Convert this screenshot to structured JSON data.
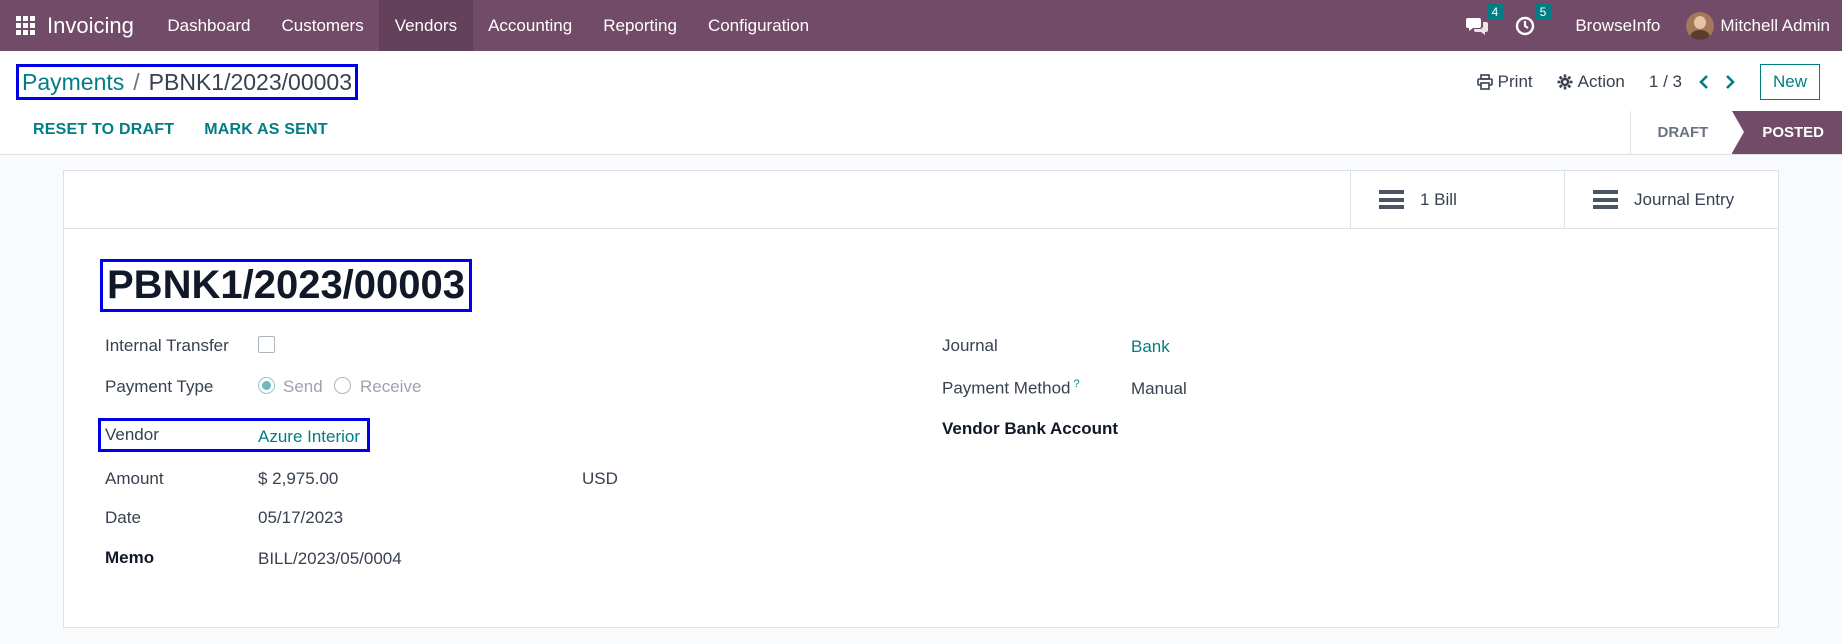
{
  "navbar": {
    "app_name": "Invoicing",
    "menu": [
      "Dashboard",
      "Customers",
      "Vendors",
      "Accounting",
      "Reporting",
      "Configuration"
    ],
    "active_menu": "Vendors",
    "messages_count": "4",
    "activities_count": "5",
    "company": "BrowseInfo",
    "user": "Mitchell Admin"
  },
  "breadcrumb": {
    "parent": "Payments",
    "separator": "/",
    "current": "PBNK1/2023/00003"
  },
  "toolbar": {
    "print_label": "Print",
    "action_label": "Action",
    "pager": "1 / 3",
    "new_label": "New"
  },
  "actions": {
    "reset_label": "RESET TO DRAFT",
    "mark_sent_label": "MARK AS SENT"
  },
  "status": {
    "draft": "DRAFT",
    "posted": "POSTED",
    "current": "POSTED"
  },
  "smart_buttons": {
    "bill": "1 Bill",
    "journal": "Journal Entry"
  },
  "form": {
    "title": "PBNK1/2023/00003",
    "internal_transfer_label": "Internal Transfer",
    "internal_transfer_checked": false,
    "payment_type_label": "Payment Type",
    "payment_type_send": "Send",
    "payment_type_receive": "Receive",
    "payment_type_selected": "Send",
    "vendor_label": "Vendor",
    "vendor_value": "Azure Interior",
    "amount_label": "Amount",
    "amount_value": "$ 2,975.00",
    "currency": "USD",
    "date_label": "Date",
    "date_value": "05/17/2023",
    "memo_label": "Memo",
    "memo_value": "BILL/2023/05/0004",
    "journal_label": "Journal",
    "journal_value": "Bank",
    "payment_method_label": "Payment Method",
    "payment_method_help": "?",
    "payment_method_value": "Manual",
    "vendor_bank_label": "Vendor Bank Account"
  },
  "colors": {
    "navbar": "#714b67",
    "accent": "#017e84",
    "highlight_box": "#0000e6"
  }
}
